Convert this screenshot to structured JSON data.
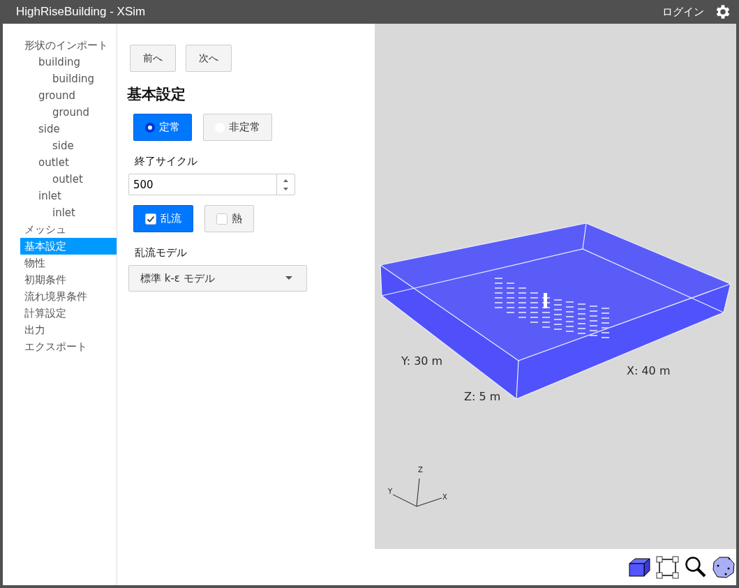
{
  "window": {
    "title": "HighRiseBuilding - XSim",
    "login": "ログイン"
  },
  "sidebar": {
    "items": [
      {
        "label": "形状のインポート",
        "selected": false,
        "children": [
          {
            "label": "building",
            "selected": false,
            "children": [
              {
                "label": "building",
                "selected": false
              }
            ]
          },
          {
            "label": "ground",
            "selected": false,
            "children": [
              {
                "label": "ground",
                "selected": false
              }
            ]
          },
          {
            "label": "side",
            "selected": false,
            "children": [
              {
                "label": "side",
                "selected": false
              }
            ]
          },
          {
            "label": "outlet",
            "selected": false,
            "children": [
              {
                "label": "outlet",
                "selected": false
              }
            ]
          },
          {
            "label": "inlet",
            "selected": false,
            "children": [
              {
                "label": "inlet",
                "selected": false
              }
            ]
          }
        ]
      },
      {
        "label": "メッシュ",
        "selected": false
      },
      {
        "label": "基本設定",
        "selected": true
      },
      {
        "label": "物性",
        "selected": false
      },
      {
        "label": "初期条件",
        "selected": false
      },
      {
        "label": "流れ境界条件",
        "selected": false
      },
      {
        "label": "計算設定",
        "selected": false
      },
      {
        "label": "出力",
        "selected": false
      },
      {
        "label": "エクスポート",
        "selected": false
      }
    ]
  },
  "nav_buttons": [
    "前へ",
    "次へ"
  ],
  "heading": "基本設定",
  "modes": [
    {
      "label": "定常",
      "selected": true
    },
    {
      "label": "非定常",
      "selected": false
    }
  ],
  "end_cycle": {
    "label": "終了サイクル",
    "value": "500"
  },
  "options": [
    {
      "label": "乱流",
      "checked": true
    },
    {
      "label": "熱",
      "checked": false
    }
  ],
  "turbulence_model": {
    "label": "乱流モデル",
    "value": "標準 k-ε モデル"
  },
  "viewport": {
    "dimensions": {
      "y": "Y: 30 m",
      "x": "X: 40 m",
      "z": "Z: 5 m"
    },
    "axes": {
      "x": "X",
      "y": "Y",
      "z": "Z"
    }
  }
}
